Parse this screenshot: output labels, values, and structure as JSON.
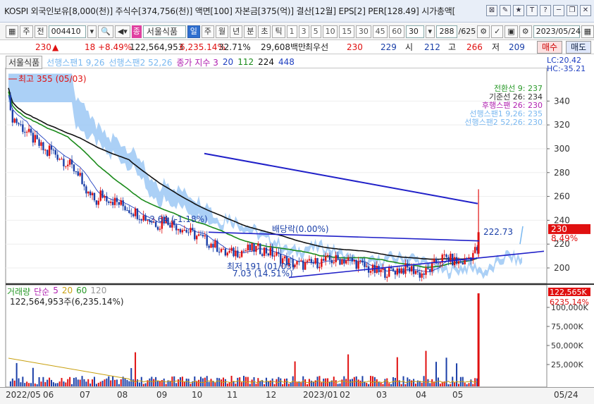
{
  "titlebar": {
    "text": "KOSPI 외국인보유[8,000(천)] 주식수[374,756(천)] 액면[100] 자본금[375(억)] 결산[12월] EPS[2] PER[128.49] 시가총액[",
    "icons": [
      "pin-icon",
      "edit-icon",
      "star-icon",
      "text-icon",
      "help-icon",
      "minimize-icon",
      "restore-icon",
      "close-icon"
    ],
    "glyphs": [
      "⊠",
      "✎",
      "★",
      "T",
      "?",
      "─",
      "❐",
      "✕"
    ]
  },
  "toolbar": {
    "kind": "주",
    "pre": "전",
    "code": "004410",
    "tag": "종",
    "name": "서울식품",
    "periods": [
      "일",
      "주",
      "월",
      "년",
      "분",
      "초",
      "틱"
    ],
    "active_period": "일",
    "intervals": [
      "1",
      "3",
      "5",
      "10",
      "15",
      "30",
      "45",
      "60"
    ],
    "interval_value": "30",
    "count": "288",
    "total": "/625",
    "date": "2023/05/24"
  },
  "quote": {
    "price": "230",
    "arrow": "▲",
    "change": "18",
    "rate": "+8.49%",
    "volume": "122,564,953",
    "vol_rate": "6,235.14%",
    "turnover": "32.71%",
    "amount": "29,608백만",
    "pref": "최우선",
    "ask": "230",
    "bid": "229",
    "open_label": "시",
    "open": "212",
    "high_label": "고",
    "high": "266",
    "low_label": "저",
    "low": "209",
    "buy": "매수",
    "sell": "매도"
  },
  "legend": {
    "name": "서울식품",
    "span1": "선행스팬1 9,26",
    "span2": "선행스팬2 52,26",
    "ma_title": "종가 지수 3",
    "ma_periods": [
      "20",
      "112",
      "224",
      "448"
    ]
  },
  "right_labels": {
    "lc": "LC:20.42",
    "hc": "HC:-35.21"
  },
  "indicators": [
    {
      "label": "전환선 9: 237",
      "color": "#2a9a2a"
    },
    {
      "label": "기준선 26: 234",
      "color": "#333333"
    },
    {
      "label": "후행스팬 26: 230",
      "color": "#b020b0"
    },
    {
      "label": "선행스팬1 9,26: 235",
      "color": "#7ab8f0"
    },
    {
      "label": "선행스팬2 52,26: 230",
      "color": "#7ab8f0"
    }
  ],
  "annotations": {
    "high": "최고 355 (05/03)",
    "change1": "-2.64 (-1.18%)",
    "ratio": "배당락(0.00%)",
    "low": "최저 191 (01/03)",
    "low_change": "7.03 (14.51%)",
    "trend_value": "222.73"
  },
  "price_axis": {
    "ticks": [
      340,
      320,
      300,
      280,
      260,
      240,
      220,
      200
    ],
    "range": [
      187,
      368
    ],
    "current": "230",
    "current_rate": "8.49%"
  },
  "volume_panel": {
    "title": "거래량",
    "ma_label": "단순",
    "ma": [
      "5",
      "20",
      "60",
      "120"
    ],
    "value": "122,564,953주(6,235.14%)",
    "current": "122,565K",
    "current_rate": "6235.14%",
    "ticks": [
      "100,000K",
      "75,000K",
      "50,000K",
      "25,000K"
    ]
  },
  "x_axis": {
    "labels": [
      "2022/05",
      "06",
      "07",
      "08",
      "09",
      "10",
      "11",
      "12",
      "2023/01",
      "02",
      "03",
      "04",
      "05"
    ],
    "right": "05/24"
  },
  "colors": {
    "up": "#e01010",
    "down": "#1a3fa8",
    "cloud": "#9cc8f4",
    "ma20": "#1a8a1a",
    "ma112": "#111111",
    "trend": "#2020c8"
  }
}
